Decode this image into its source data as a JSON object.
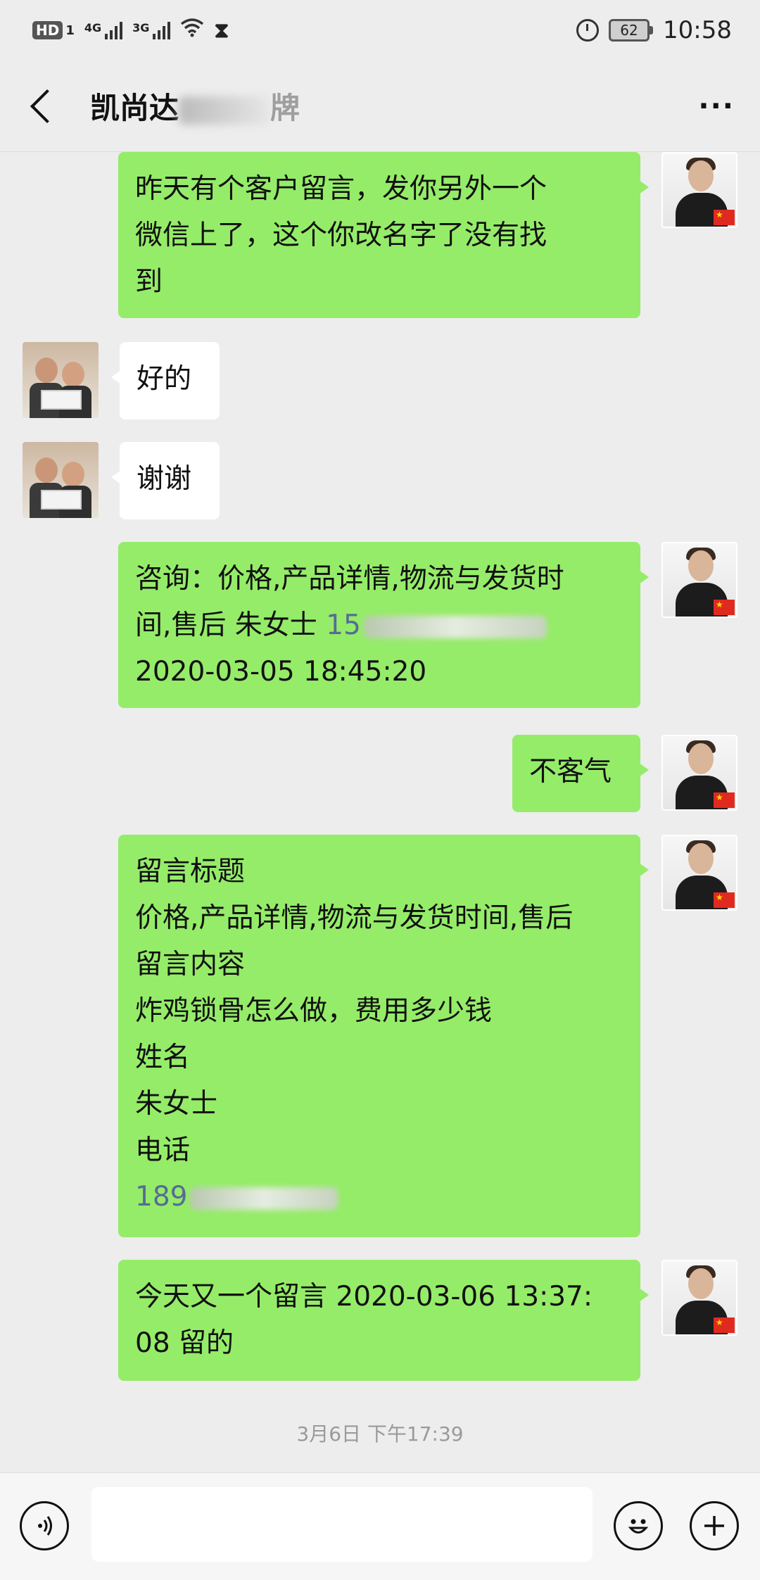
{
  "status_bar": {
    "hd": "HD",
    "sim": "1",
    "net1": "4G",
    "net2": "3G",
    "battery": "62",
    "time": "10:58"
  },
  "header": {
    "title": "凯尚达",
    "title_tail": "牌"
  },
  "messages": [
    {
      "sender": "self",
      "lines": [
        "昨天有个客户留言，发你另外一个",
        "微信上了，这个你改名字了没有找",
        "到"
      ]
    },
    {
      "sender": "other",
      "lines": [
        "好的"
      ]
    },
    {
      "sender": "other",
      "lines": [
        "谢谢"
      ]
    },
    {
      "sender": "self",
      "lines": [
        "咨询：价格,产品详情,物流与发货时",
        "间,售后 朱女士 "
      ],
      "phone_prefix": "15",
      "tail_line": "2020-03-05 18:45:20"
    },
    {
      "sender": "self",
      "lines": [
        "不客气"
      ]
    },
    {
      "sender": "self",
      "lines": [
        "留言标题",
        "价格,产品详情,物流与发货时间,售后",
        "留言内容",
        "炸鸡锁骨怎么做，费用多少钱",
        "姓名",
        "朱女士",
        "电话"
      ],
      "phone_prefix": "189"
    },
    {
      "sender": "self",
      "lines": [
        "今天又一个留言 2020-03-06 13:37:",
        "08 留的"
      ]
    }
  ],
  "timestamp": "3月6日 下午17:39",
  "input": {
    "value": "",
    "placeholder": ""
  },
  "icons": {
    "voice": "voice-icon",
    "emoji": "emoji-icon",
    "plus": "plus-icon"
  }
}
